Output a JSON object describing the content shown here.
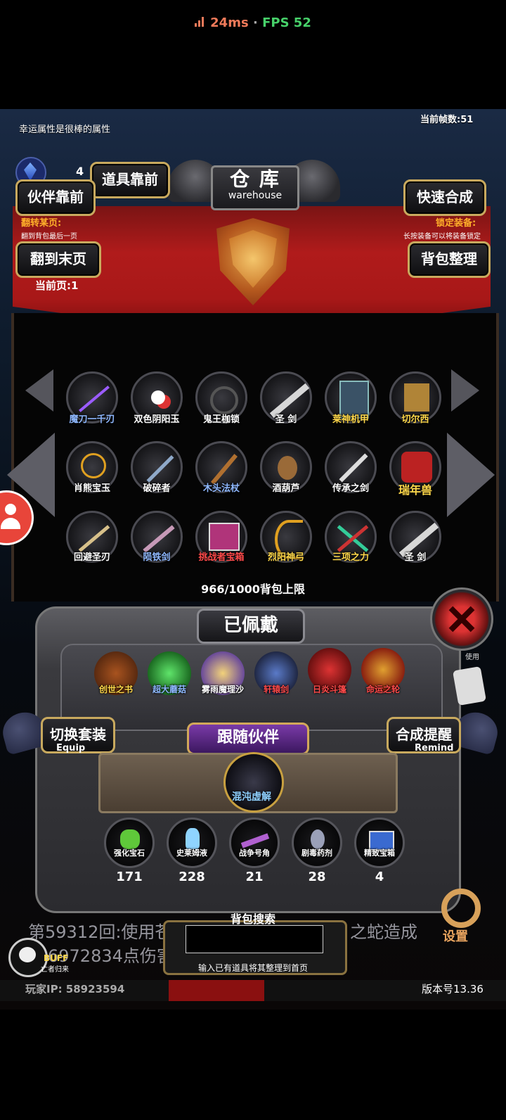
{
  "status": {
    "ping": "24ms",
    "separator": "·",
    "fps": "FPS 52"
  },
  "header": {
    "luck_text": "幸运属性是很棒的属性",
    "frame_count": "当前帧数:51",
    "currency_value": "4",
    "title_cn": "仓 库",
    "title_en": "warehouse"
  },
  "buttons": {
    "item_front": "道具靠前",
    "partner_front": "伙伴靠前",
    "quick_merge": "快速合成",
    "flip_to_end": "翻到末页",
    "bag_sort": "背包整理",
    "switch_set": "切换套装",
    "switch_set_en": "Equip",
    "merge_remind": "合成提醒",
    "merge_remind_en": "Remind",
    "settings": "设置"
  },
  "hints": {
    "flip_page_title": "翻转某页:",
    "flip_page_desc": "翻到背包最后一页",
    "lock_title": "锁定装备:",
    "lock_desc": "长按装备可以将装备锁定",
    "current_page": "当前页:1"
  },
  "inventory": {
    "rows": [
      [
        {
          "name": "魔刀一千刃",
          "color": "#8fb8ff"
        },
        {
          "name": "双色阴阳玉",
          "color": "#ffffff"
        },
        {
          "name": "鬼王枷锁",
          "color": "#ffffff"
        },
        {
          "name": "圣 剑",
          "color": "#ffffff"
        },
        {
          "name": "莱神机甲",
          "color": "#ffd84a"
        },
        {
          "name": "切尔西",
          "color": "#ffd84a"
        }
      ],
      [
        {
          "name": "肖熊宝玉",
          "color": "#ffffff"
        },
        {
          "name": "破碎者",
          "color": "#ffffff"
        },
        {
          "name": "木头法杖",
          "color": "#8fb8ff"
        },
        {
          "name": "酒葫芦",
          "color": "#ffffff"
        },
        {
          "name": "传承之剑",
          "color": "#ffffff"
        },
        {
          "name": "瑞年兽",
          "color": "#ffd84a"
        }
      ],
      [
        {
          "name": "回避圣刃",
          "color": "#ffffff"
        },
        {
          "name": "陨铁剑",
          "color": "#8fb8ff"
        },
        {
          "name": "挑战者宝箱",
          "color": "#ff4a4a"
        },
        {
          "name": "烈阳神弓",
          "color": "#ffd84a"
        },
        {
          "name": "三项之力",
          "color": "#ffd84a"
        },
        {
          "name": "圣 剑",
          "color": "#ffffff"
        }
      ]
    ],
    "capacity": "966/1000背包上限"
  },
  "equipped": {
    "title": "已佩戴",
    "items": [
      {
        "name": "创世之书",
        "color": "#ffd84a"
      },
      {
        "name": "超大蘑菇",
        "color": "#8fb8ff"
      },
      {
        "name": "雾雨魔理沙",
        "color": "#ffffff"
      },
      {
        "name": "轩辕剑",
        "color": "#ff4a4a"
      },
      {
        "name": "日炎斗篷",
        "color": "#ff4a4a"
      },
      {
        "name": "命运之轮",
        "color": "#ff4a4a"
      }
    ],
    "use_hint": "使用"
  },
  "partner": {
    "title": "跟随伙伴",
    "name": "混沌虚解"
  },
  "consumables": [
    {
      "name": "强化宝石",
      "count": "171"
    },
    {
      "name": "史莱姆液",
      "count": "228"
    },
    {
      "name": "战争号角",
      "count": "21"
    },
    {
      "name": "剧毒药剂",
      "count": "28"
    },
    {
      "name": "精致宝箱",
      "count": "4"
    }
  ],
  "log": {
    "line1_left": "第59312回:使用苍",
    "line1_right": "之蛇造成",
    "line2": "6972834点伤害"
  },
  "search": {
    "title": "背包搜索",
    "placeholder": "",
    "hint": "输入已有道具将其整理到首页"
  },
  "footer": {
    "buff": "BUFF",
    "buff_name": "亡者归来",
    "player_ip": "玩家IP: 58923594",
    "version": "版本号13.36"
  }
}
